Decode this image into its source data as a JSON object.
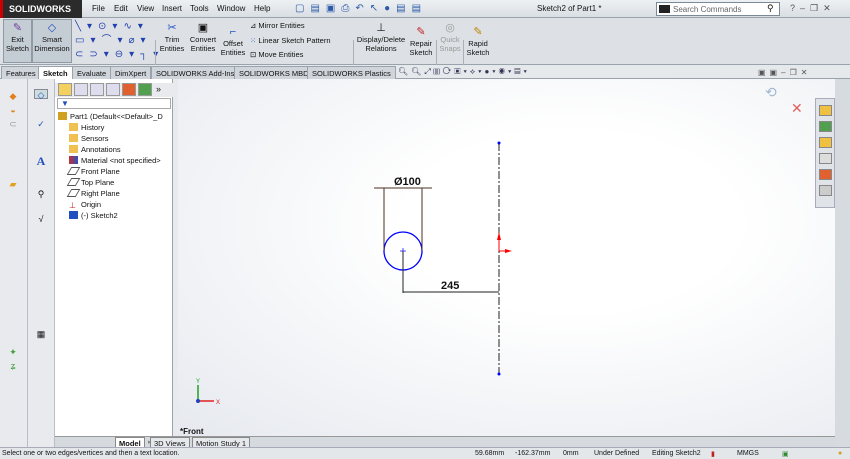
{
  "app": {
    "logo": "SOLIDWORKS",
    "document_title": "Sketch2 of Part1 *"
  },
  "menu": [
    "File",
    "Edit",
    "View",
    "Insert",
    "Tools",
    "Window",
    "Help"
  ],
  "search": {
    "placeholder": "Search Commands"
  },
  "ribbon": {
    "exit_sketch": "Exit Sketch",
    "smart_dimension": "Smart Dimension",
    "trim": "Trim Entities",
    "convert": "Convert Entities",
    "offset": "Offset Entities",
    "mirror": "Mirror Entities",
    "linear_pattern": "Linear Sketch Pattern",
    "move": "Move Entities",
    "relations": "Display/Delete Relations",
    "repair": "Repair Sketch",
    "quick_snaps": "Quick Snaps",
    "rapid": "Rapid Sketch"
  },
  "tabs": [
    {
      "label": "Features",
      "active": false
    },
    {
      "label": "Sketch",
      "active": true
    },
    {
      "label": "Evaluate",
      "active": false
    },
    {
      "label": "DimXpert",
      "active": false
    },
    {
      "label": "SOLIDWORKS Add-Ins",
      "active": false
    },
    {
      "label": "SOLIDWORKS MBD",
      "active": false
    },
    {
      "label": "SOLIDWORKS Plastics",
      "active": false
    }
  ],
  "tree": {
    "root": "Part1  (Default<<Default>_D",
    "items": [
      "History",
      "Sensors",
      "Annotations",
      "Material <not specified>",
      "Front Plane",
      "Top Plane",
      "Right Plane",
      "Origin",
      "(-) Sketch2"
    ]
  },
  "sketch": {
    "diameter_label": "Ø100",
    "distance_label": "245",
    "view_label": "*Front",
    "circle_color": "#0000ff",
    "origin_color": "#ff0000"
  },
  "bottom_tabs": [
    "Model",
    "3D Views",
    "Motion Study 1"
  ],
  "status": {
    "message": "Select one or two edges/vertices and then a text location.",
    "x": "59.68mm",
    "y": "-162.37mm",
    "z": "0mm",
    "state": "Under Defined",
    "editing": "Editing Sketch2",
    "units": "MMGS"
  }
}
